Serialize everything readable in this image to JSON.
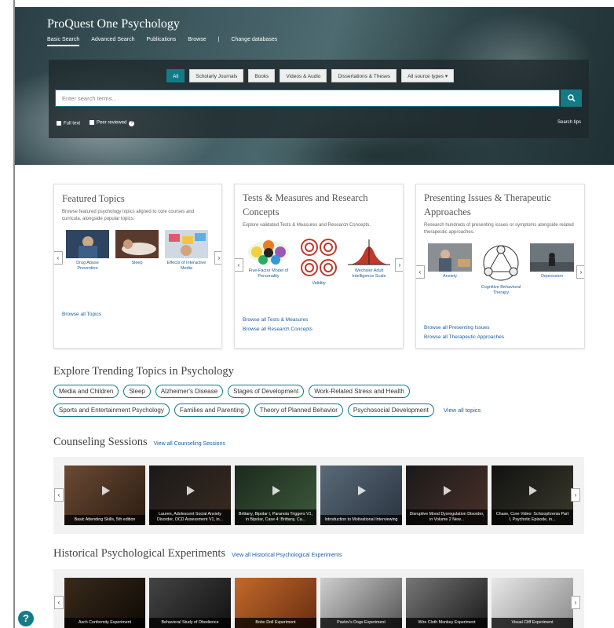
{
  "brand": "ProQuest One Psychology",
  "nav": [
    "Basic Search",
    "Advanced Search",
    "Publications",
    "Browse",
    "|",
    "Change databases"
  ],
  "source_tabs": [
    "All",
    "Scholarly Journals",
    "Books",
    "Videos & Audio",
    "Dissertations & Theses",
    "All source types"
  ],
  "search": {
    "placeholder": "Enter search terms...",
    "full_text": "Full text",
    "peer_reviewed": "Peer reviewed",
    "tips": "Search tips"
  },
  "featured": {
    "title": "Featured Topics",
    "desc": "Browse featured psychology topics aligned to core courses and curricula, alongside popular topics.",
    "items": [
      "Drug Abuse Prevention",
      "Sleep",
      "Effects of Interactive Media"
    ],
    "link": "Browse all Topics"
  },
  "tests": {
    "title": "Tests & Measures and Research Concepts",
    "desc": "Explore validated Tests & Measures and Research Concepts.",
    "items": [
      "Five-Factor Model of Personality",
      "Validity",
      "Wechsler Adult Intelligence Scale"
    ],
    "links": [
      "Browse all Tests & Measures",
      "Browse all Research Concepts"
    ]
  },
  "presenting": {
    "title": "Presenting Issues & Therapeutic Approaches",
    "desc": "Research hundreds of presenting issues or symptoms alongside related therapeutic approaches.",
    "items": [
      "Anxiety",
      "Cognitive Behavioral Therapy",
      "Depression"
    ],
    "links": [
      "Browse all Presenting Issues",
      "Browse all Therapeutic Approaches"
    ]
  },
  "trending": {
    "title": "Explore Trending Topics in Psychology",
    "row1": [
      "Media and Children",
      "Sleep",
      "Alzheimer's Disease",
      "Stages of Development",
      "Work-Related Stress and Health"
    ],
    "row2": [
      "Sports and Entertainment Psychology",
      "Families and Parenting",
      "Theory of Planned Behavior",
      "Psychosocial Development"
    ],
    "view_all": "View all topics"
  },
  "counseling": {
    "title": "Counseling Sessions",
    "view_all": "View all Counseling Sessions",
    "videos": [
      "Basic Attending Skills, 5th edition",
      "Lauren, Adolescent Social Anxiety Disorder, OCD Assessment V1, in...",
      "Brittany, Bipolar I, Paranoia Triggers V1, in Bipolar, Case 4: Brittany, Ca...",
      "Introduction to Motivational Interviewing",
      "Disruptive Mood Dysregulation Disorder, in Volume 2 New...",
      "Chase, Core Video: Schizophrenia Part I, Psychotic Episode, in..."
    ]
  },
  "historical": {
    "title": "Historical Psychological Experiments",
    "view_all": "View all Historical Psychological Experiments",
    "videos": [
      "Asch Conformity Experiment",
      "Behavioral Study of Obedience",
      "Bobo Doll Experiment",
      "Pavlov's Dogs Experiment",
      "Wire Cloth Monkey Experiment",
      "Visual Cliff Experiment"
    ]
  }
}
